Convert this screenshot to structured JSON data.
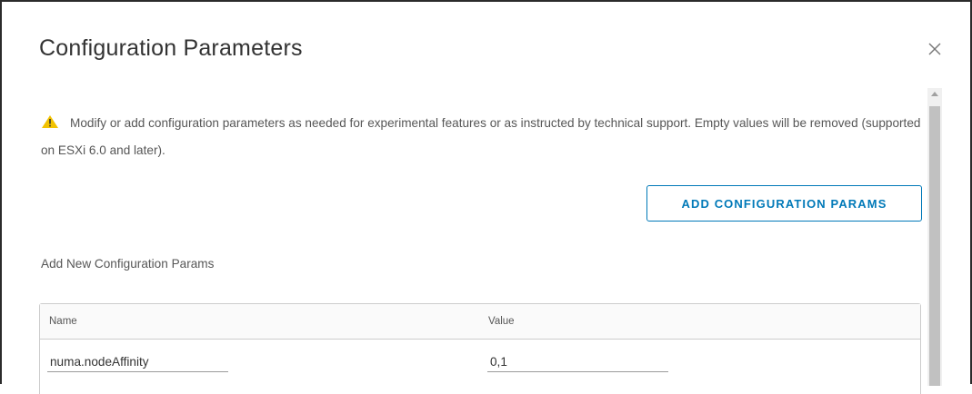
{
  "dialog": {
    "title": "Configuration Parameters",
    "close_icon": "close-icon"
  },
  "warning": {
    "icon": "warning-icon",
    "icon_color": "#f2c200",
    "text": "Modify or add configuration parameters as needed for experimental features or as instructed by technical support. Empty values will be removed (supported on ESXi 6.0 and later)."
  },
  "actions": {
    "add_params_label": "ADD CONFIGURATION PARAMS",
    "accent_color": "#0079b8"
  },
  "new_params": {
    "section_label": "Add New Configuration Params",
    "columns": [
      "Name",
      "Value"
    ],
    "rows": [
      {
        "name": "numa.nodeAffinity",
        "value": "0,1"
      }
    ]
  }
}
